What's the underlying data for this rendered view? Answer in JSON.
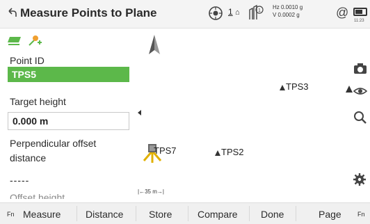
{
  "header": {
    "title": "Measure Points to Plane",
    "hz_value": "Hz 0.0010 g",
    "v_value": "V  0.0002 g",
    "prism_count": "1",
    "target_count": "1",
    "at_symbol": "@",
    "time": "11:23"
  },
  "form": {
    "point_id_label": "Point ID",
    "point_id_value": "TPS5",
    "target_height_label": "Target height",
    "target_height_value": "0.000 m",
    "perp_offset_label_1": "Perpendicular offset",
    "perp_offset_label_2": "distance",
    "perp_offset_value": "-----",
    "offset_height_label": "Offset height"
  },
  "map": {
    "points": [
      "TPS3",
      "TPS7",
      "TPS2"
    ],
    "scale_label": "35 m"
  },
  "softkeys": {
    "fn_left": "Fn",
    "measure": "Measure",
    "distance": "Distance",
    "store": "Store",
    "compare": "Compare",
    "done": "Done",
    "page": "Page",
    "fn_right": "Fn"
  },
  "colors": {
    "accent_green": "#5cb84a",
    "text": "#2b2b2b"
  },
  "icons": [
    "back-icon",
    "prism-icon",
    "target-icon",
    "battery-icon",
    "camera-icon",
    "visibility-icon",
    "search-icon",
    "settings-icon",
    "north-arrow-icon"
  ]
}
